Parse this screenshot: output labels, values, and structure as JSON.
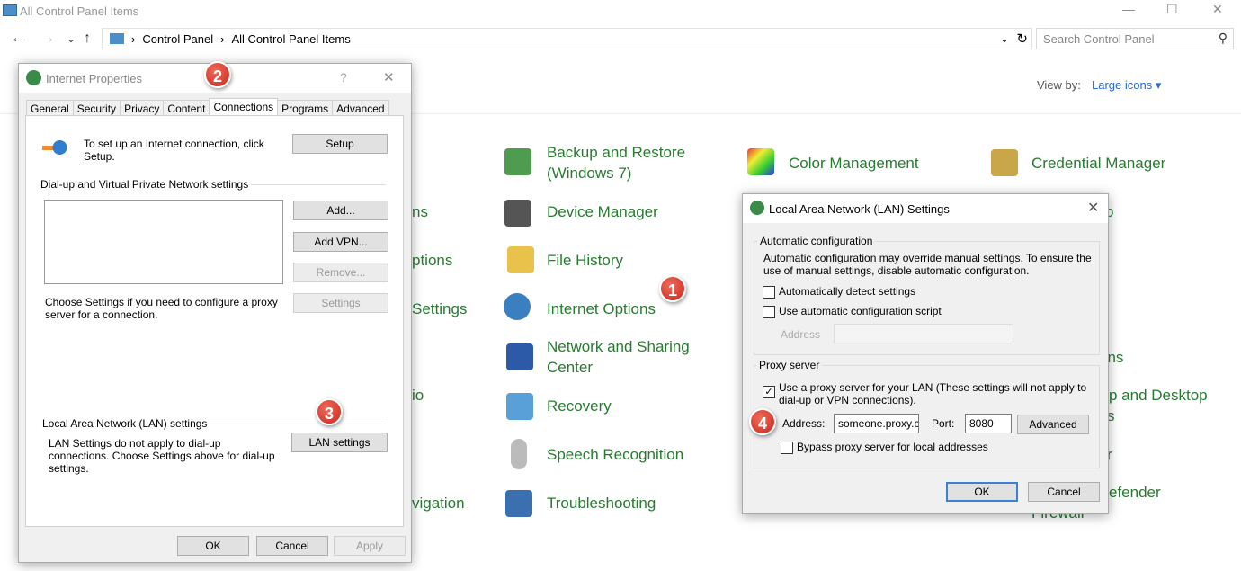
{
  "window": {
    "title": "All Control Panel Items",
    "minimize": "—",
    "maximize": "☐",
    "close": "✕"
  },
  "nav": {
    "back": "←",
    "forward": "→",
    "recent": "⌄",
    "up": "↑",
    "breadcrumb": [
      "Control Panel",
      "All Control Panel Items"
    ],
    "refresh": "↻",
    "dropdown": "⌄",
    "search_placeholder": "Search Control Panel",
    "search_icon": "⚲"
  },
  "view_by": {
    "label": "View by:",
    "value": "Large icons",
    "arrow": "▾"
  },
  "items": {
    "partial_col2": [
      "ns",
      "ptions",
      "Settings",
      "io",
      "vigation"
    ],
    "col3": [
      "Backup and Restore (Windows 7)",
      "Device Manager",
      "File History",
      "Internet Options",
      "Network and Sharing Center",
      "Recovery",
      "Speech Recognition",
      "Troubleshooting"
    ],
    "col4": [
      "Color Management"
    ],
    "col5": [
      "Credential Manager"
    ],
    "partial_col5": [
      "o",
      "ons",
      "p and Desktop",
      "s",
      "r",
      "efender",
      "Firewall"
    ]
  },
  "internet_properties": {
    "title": "Internet Properties",
    "help": "?",
    "close": "✕",
    "tabs": [
      "General",
      "Security",
      "Privacy",
      "Content",
      "Connections",
      "Programs",
      "Advanced"
    ],
    "active_tab": "Connections",
    "setup_text": "To set up an Internet connection, click Setup.",
    "setup_button": "Setup",
    "dialup_heading": "Dial-up and Virtual Private Network settings",
    "add_button": "Add...",
    "add_vpn_button": "Add VPN...",
    "remove_button": "Remove...",
    "settings_button": "Settings",
    "proxy_text": "Choose Settings if you need to configure a proxy server for a connection.",
    "lan_heading": "Local Area Network (LAN) settings",
    "lan_text": "LAN Settings do not apply to dial-up connections. Choose Settings above for dial-up settings.",
    "lan_button": "LAN settings",
    "ok": "OK",
    "cancel": "Cancel",
    "apply": "Apply"
  },
  "lan_settings": {
    "title": "Local Area Network (LAN) Settings",
    "close": "✕",
    "auto_group": "Automatic configuration",
    "auto_text": "Automatic configuration may override manual settings.  To ensure the use of manual settings, disable automatic configuration.",
    "auto_detect": {
      "label": "Automatically detect settings",
      "checked": false
    },
    "auto_script": {
      "label": "Use automatic configuration script",
      "checked": false
    },
    "script_address_label": "Address",
    "script_address_value": "",
    "proxy_group": "Proxy server",
    "use_proxy": {
      "label": "Use a proxy server for your LAN (These settings will not apply to dial-up or VPN connections).",
      "checked": true
    },
    "address_label": "Address:",
    "address_value": "someone.proxy.c",
    "port_label": "Port:",
    "port_value": "8080",
    "advanced_button": "Advanced",
    "bypass": {
      "label": "Bypass proxy server for local addresses",
      "checked": false
    },
    "ok": "OK",
    "cancel": "Cancel"
  },
  "badges": [
    "1",
    "2",
    "3",
    "4"
  ],
  "colors": {
    "link_green": "#2a7a32",
    "badge_red": "#d0322a",
    "default_button_border": "#3c7fd3"
  }
}
